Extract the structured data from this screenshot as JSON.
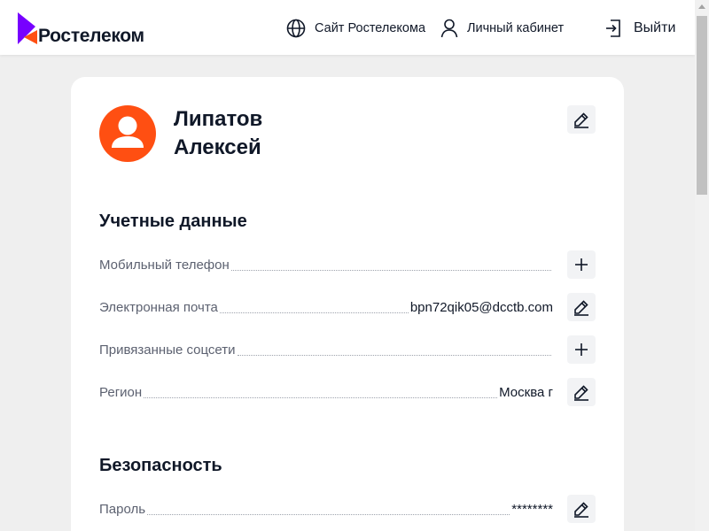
{
  "brand": {
    "name": "Ростелеком",
    "color_purple": "#7700ff",
    "color_orange": "#ff4f12"
  },
  "header": {
    "site_link": "Сайт Ростелекома",
    "cabinet_link": "Личный кабинет",
    "logout": "Выйти",
    "icons": {
      "site": "globe-icon",
      "cabinet": "user-icon",
      "logout": "logout-icon"
    }
  },
  "profile": {
    "last_name": "Липатов",
    "first_name": "Алексей",
    "avatar_icon": "user-avatar-icon"
  },
  "account_section": {
    "title": "Учетные данные",
    "rows": [
      {
        "label": "Мобильный телефон",
        "value": "",
        "action_icon": "plus-icon"
      },
      {
        "label": "Электронная почта",
        "value": "bpn72qik05@dcctb.com",
        "action_icon": "pencil-icon"
      },
      {
        "label": "Привязанные соцсети",
        "value": "",
        "action_icon": "plus-icon"
      },
      {
        "label": "Регион",
        "value": "Москва г",
        "action_icon": "pencil-icon"
      }
    ]
  },
  "security_section": {
    "title": "Безопасность",
    "rows": [
      {
        "label": "Пароль",
        "value": "********",
        "action_icon": "pencil-icon"
      }
    ]
  }
}
